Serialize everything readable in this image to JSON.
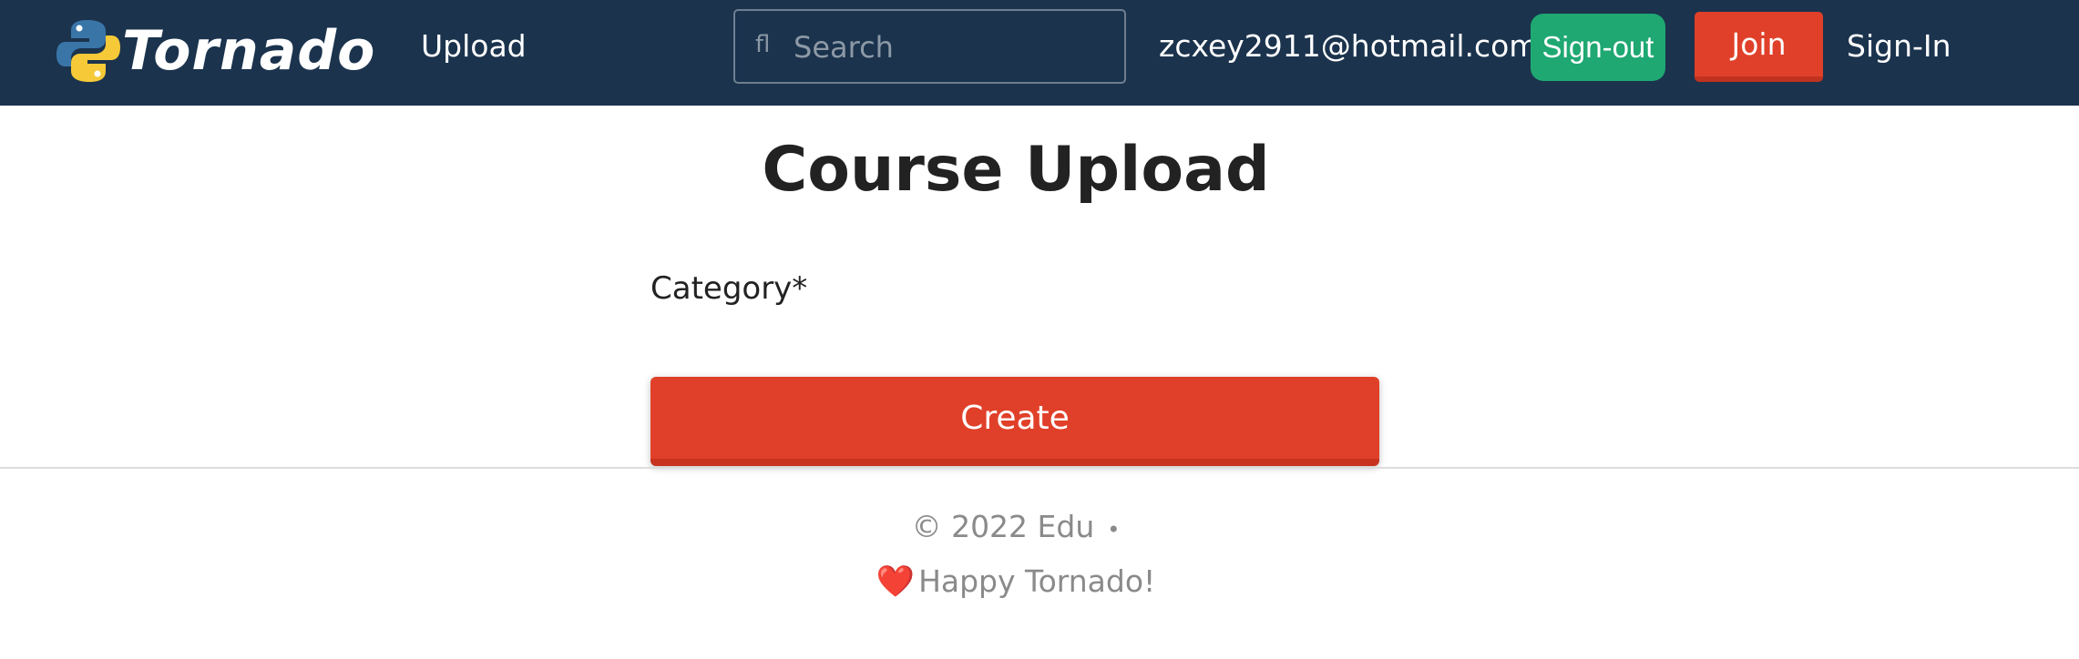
{
  "navbar": {
    "brand": "Tornado",
    "brand_icon": "python-logo-icon",
    "upload_label": "Upload",
    "search": {
      "icon": "search-icon",
      "icon_glyph": "fl",
      "placeholder": "Search",
      "value": ""
    },
    "user_email": "zcxey2911@hotmail.com",
    "signout_label": "Sign-out",
    "join_label": "Join",
    "signin_label": "Sign-In"
  },
  "main": {
    "title": "Course Upload",
    "category_label": "Category*",
    "create_label": "Create"
  },
  "footer": {
    "copyright": "© 2022 Edu",
    "separator": "•",
    "heart_glyph": "❤️",
    "tagline": "Happy Tornado!"
  },
  "colors": {
    "navbar_bg": "#1b334d",
    "primary_red": "#e04029",
    "signout_green": "#1fa872",
    "text_dark": "#222222",
    "footer_text": "#8a8a8a",
    "python_blue": "#3a75a8",
    "python_yellow": "#f5c938"
  }
}
